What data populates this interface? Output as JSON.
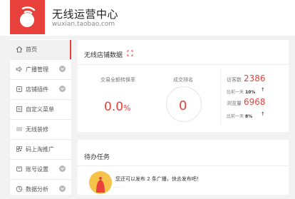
{
  "header": {
    "title": "无线运营中心",
    "subtitle": "wuxian.taobao.com",
    "brand_color": "#e8403a"
  },
  "sidebar": {
    "items": [
      {
        "label": "首页",
        "icon": "home-icon",
        "active": true,
        "expandable": false
      },
      {
        "label": "广播管理",
        "icon": "broadcast-icon",
        "active": false,
        "expandable": true
      },
      {
        "label": "店铺插件",
        "icon": "plugin-icon",
        "active": false,
        "expandable": true
      },
      {
        "label": "自定义菜单",
        "icon": "menu-icon",
        "active": false,
        "expandable": false
      },
      {
        "label": "无线装修",
        "icon": "decor-icon",
        "active": false,
        "expandable": false
      },
      {
        "label": "码上淘推广",
        "icon": "qr-icon",
        "active": false,
        "expandable": false
      },
      {
        "label": "账号设置",
        "icon": "account-icon",
        "active": false,
        "expandable": true
      },
      {
        "label": "数据分析",
        "icon": "chart-icon",
        "active": false,
        "expandable": true
      }
    ]
  },
  "store_data": {
    "title": "无线店铺数据",
    "conversion": {
      "label": "交易全额转换率",
      "value": "0.0",
      "unit": "%"
    },
    "ranking": {
      "label": "成交排名",
      "value": "0"
    },
    "visitors": {
      "label": "访客数",
      "value": "2386",
      "compare_prefix": "比前一天",
      "compare_value": "10%",
      "trend": "up"
    },
    "pageviews": {
      "label": "浏览量",
      "value": "6968",
      "compare_prefix": "比前一天",
      "compare_value": "8%",
      "trend": "up"
    }
  },
  "todo": {
    "title": "待办任务",
    "message": "您还可以发布 2 条广播，快去发布吧！",
    "sub": "· · ·"
  }
}
